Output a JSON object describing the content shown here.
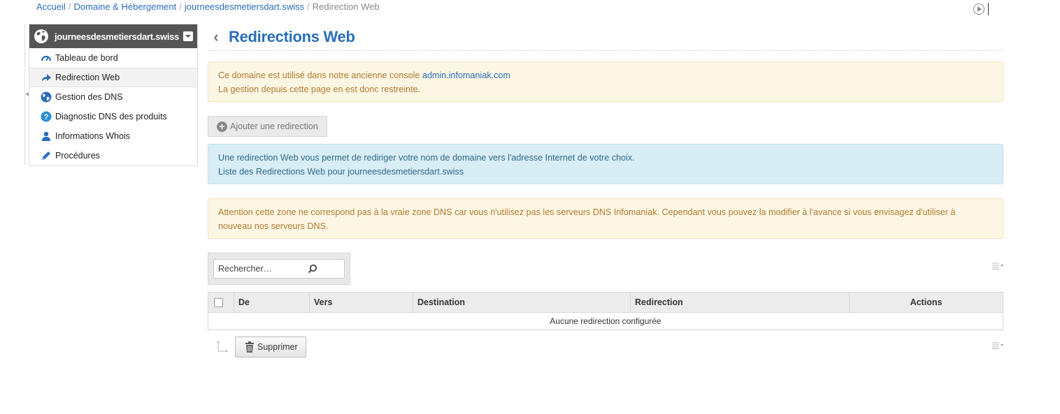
{
  "breadcrumb": {
    "items": [
      "Accueil",
      "Domaine & Hébergement",
      "journeesdesmetiersdart.swiss"
    ],
    "current": "Redirection Web",
    "separator": "/"
  },
  "sidebar": {
    "domain": "journeesdesmetiersdart.swiss",
    "items": [
      {
        "label": "Tableau de bord",
        "icon": "dashboard-icon"
      },
      {
        "label": "Redirection Web",
        "icon": "redirect-arrow-icon",
        "active": true
      },
      {
        "label": "Gestion des DNS",
        "icon": "globe-icon"
      },
      {
        "label": "Diagnostic DNS des produits",
        "icon": "help-icon"
      },
      {
        "label": "Informations Whois",
        "icon": "user-icon"
      },
      {
        "label": "Procédures",
        "icon": "pencil-icon"
      }
    ]
  },
  "page": {
    "title": "Redirections Web"
  },
  "alerts": {
    "legacy_text": "Ce domaine est utilisé dans notre ancienne console",
    "legacy_link": "admin.infomaniak.com",
    "legacy_line2": "La gestion depuis cette page en est donc restreinte.",
    "info_line1": "Une redirection Web vous permet de rediriger votre nom de domaine vers l'adresse Internet de votre choix.",
    "info_line2": "Liste des Redirections Web pour journeesdesmetiersdart.swiss",
    "dns_warning": "Attention cette zone ne correspond pas à la vraie zone DNS car vous n'utilisez pas les serveurs DNS Infomaniak. Cependant vous pouvez la modifier à l'avance si vous envisagez d'utiliser à nouveau nos serveurs DNS."
  },
  "actions": {
    "add_label": "Ajouter une redirection",
    "delete_label": "Supprimer"
  },
  "search": {
    "placeholder": "Rechercher…"
  },
  "table": {
    "columns": [
      "De",
      "Vers",
      "Destination",
      "Redirection",
      "Actions"
    ],
    "empty_message": "Aucune redirection configurée"
  },
  "colors": {
    "accent": "#2a6ebb",
    "warning_bg": "#fcf6e5",
    "info_bg": "#d9edf7",
    "sidebar_header": "#555555"
  }
}
